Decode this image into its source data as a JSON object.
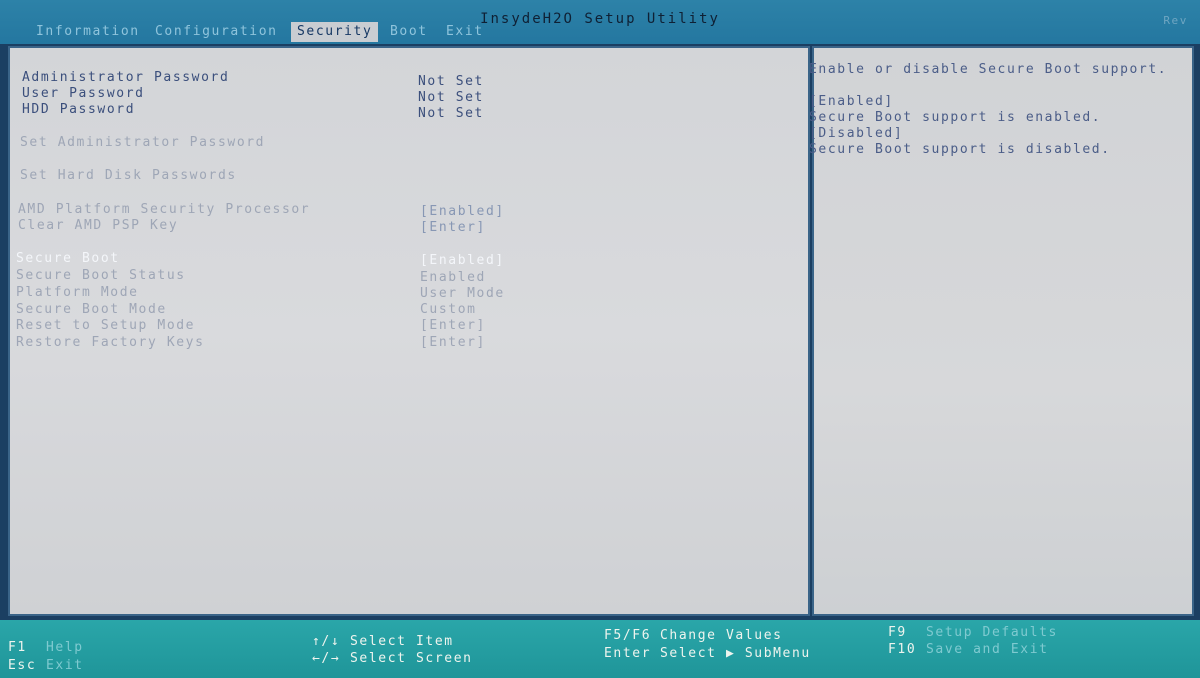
{
  "header": {
    "title": "InsydeH2O Setup Utility",
    "corner": "Rev",
    "tabs": [
      {
        "label": "Information"
      },
      {
        "label": "Configuration"
      },
      {
        "label": "Security",
        "active": true
      },
      {
        "label": "Boot"
      },
      {
        "label": "Exit"
      }
    ]
  },
  "menu": {
    "admin_password": {
      "label": "Administrator Password",
      "value": "Not Set"
    },
    "user_password": {
      "label": "User Password",
      "value": "Not Set"
    },
    "hdd_password": {
      "label": "HDD Password",
      "value": "Not Set"
    },
    "set_admin_password": {
      "label": "Set Administrator Password"
    },
    "set_hdd_passwords": {
      "label": "Set Hard Disk Passwords"
    },
    "amd_psp": {
      "label": "AMD Platform Security Processor",
      "value": "[Enabled]"
    },
    "clear_psp_key": {
      "label": "Clear AMD PSP Key",
      "value": "[Enter]"
    },
    "secure_boot": {
      "label": "Secure Boot",
      "value": "[Enabled]"
    },
    "secure_boot_status": {
      "label": "Secure Boot Status",
      "value": "Enabled"
    },
    "platform_mode": {
      "label": "Platform Mode",
      "value": "User Mode"
    },
    "secure_boot_mode": {
      "label": "Secure Boot Mode",
      "value": "Custom"
    },
    "reset_setup_mode": {
      "label": "Reset to Setup Mode",
      "value": "[Enter]"
    },
    "restore_factory_keys": {
      "label": "Restore Factory Keys",
      "value": "[Enter]"
    }
  },
  "help": {
    "lines": [
      "Enable or disable Secure Boot support.",
      "[Enabled]",
      "Secure Boot support is enabled.",
      "[Disabled]",
      "Secure Boot support is disabled."
    ]
  },
  "footer": {
    "f1": {
      "key": "F1",
      "desc": "Help"
    },
    "esc": {
      "key": "Esc",
      "desc": "Exit"
    },
    "updown": {
      "key": "↑/↓",
      "desc": "Select Item"
    },
    "leftright": {
      "key": "←/→",
      "desc": "Select Screen"
    },
    "f5f6": {
      "key": "F5/F6",
      "desc": "Change Values"
    },
    "enter": {
      "key": "Enter",
      "desc": "Select ▶ SubMenu"
    },
    "f9": {
      "key": "F9",
      "desc": "Setup Defaults"
    },
    "f10": {
      "key": "F10",
      "desc": "Save and Exit"
    }
  }
}
